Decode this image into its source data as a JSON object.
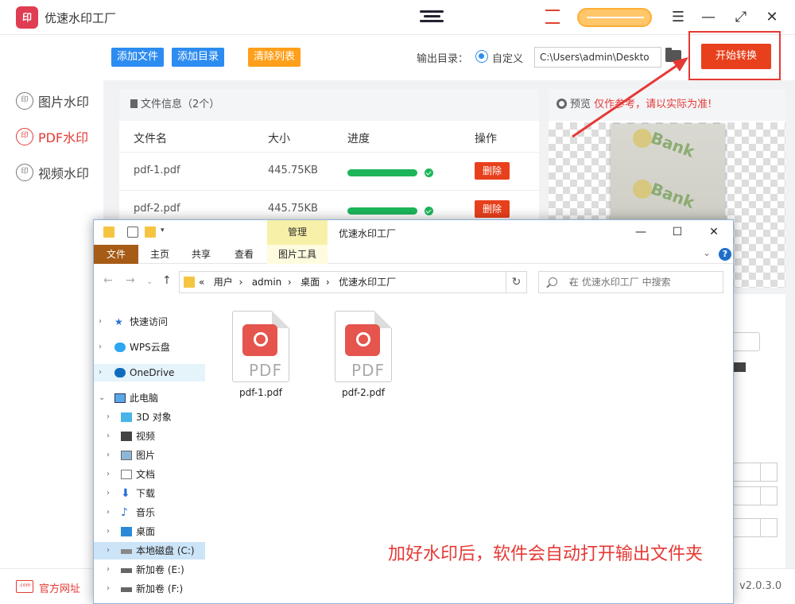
{
  "app": {
    "title": "优速水印工厂",
    "logo_text": "印",
    "version": "v2.0.3.0",
    "website_label": "官方网址",
    "website_icon_text": ".com",
    "window_controls": {
      "menu": "☰",
      "minimize": "—",
      "maximize": "⤢",
      "close": "✕"
    }
  },
  "sidebar": {
    "items": [
      {
        "label": "图片水印",
        "icon": "印",
        "active": false
      },
      {
        "label": "PDF水印",
        "icon": "印",
        "active": true
      },
      {
        "label": "视频水印",
        "icon": "印",
        "active": false
      }
    ]
  },
  "toolbar": {
    "add_file": "添加文件",
    "add_folder": "添加目录",
    "clear_list": "清除列表",
    "output_label": "输出目录：",
    "custom_label": "自定义",
    "output_path": "C:\\Users\\admin\\Deskto",
    "start_button": "开始转换"
  },
  "file_panel": {
    "header": "文件信息（2个）",
    "columns": [
      "文件名",
      "大小",
      "进度",
      "操作"
    ],
    "rows": [
      {
        "name": "pdf-1.pdf",
        "size": "445.75KB",
        "progress": 1.0,
        "action": "删除"
      },
      {
        "name": "pdf-2.pdf",
        "size": "445.75KB",
        "progress": 1.0,
        "action": "删除"
      }
    ]
  },
  "preview": {
    "label": "预览",
    "warning": "仅作参考，请以实际为准!",
    "watermark_text": "Bank"
  },
  "explorer": {
    "title": "优速水印工厂",
    "manage_tab": "管理",
    "ribbon_tabs": [
      "文件",
      "主页",
      "共享",
      "查看",
      "图片工具"
    ],
    "address": [
      "用户",
      "admin",
      "桌面",
      "优速水印工厂"
    ],
    "address_prefix": "«",
    "search_placeholder": "在 优速水印工厂 中搜索",
    "nav": [
      {
        "label": "快速访问",
        "icon": "star-icon"
      },
      {
        "label": "WPS云盘",
        "icon": "cloud-icon"
      },
      {
        "label": "OneDrive",
        "icon": "onedrive-icon"
      },
      {
        "label": "此电脑",
        "icon": "computer-icon"
      },
      {
        "label": "3D 对象",
        "icon": "cube-icon"
      },
      {
        "label": "视频",
        "icon": "video-icon"
      },
      {
        "label": "图片",
        "icon": "picture-icon"
      },
      {
        "label": "文档",
        "icon": "document-icon"
      },
      {
        "label": "下载",
        "icon": "download-icon"
      },
      {
        "label": "音乐",
        "icon": "music-icon"
      },
      {
        "label": "桌面",
        "icon": "desktop-icon"
      },
      {
        "label": "本地磁盘 (C:)",
        "icon": "drive-icon"
      },
      {
        "label": "新加卷 (E:)",
        "icon": "drive-icon"
      },
      {
        "label": "新加卷 (F:)",
        "icon": "drive-icon"
      }
    ],
    "files": [
      {
        "name": "pdf-1.pdf",
        "type_label": "PDF"
      },
      {
        "name": "pdf-2.pdf",
        "type_label": "PDF"
      }
    ],
    "caption": "加好水印后，软件会自动打开输出文件夹"
  },
  "colors": {
    "accent_red": "#e53935",
    "button_blue": "#2d8cf0",
    "button_orange": "#ff9f1a",
    "start_button": "#e8401c",
    "progress_green": "#1cb55a"
  }
}
